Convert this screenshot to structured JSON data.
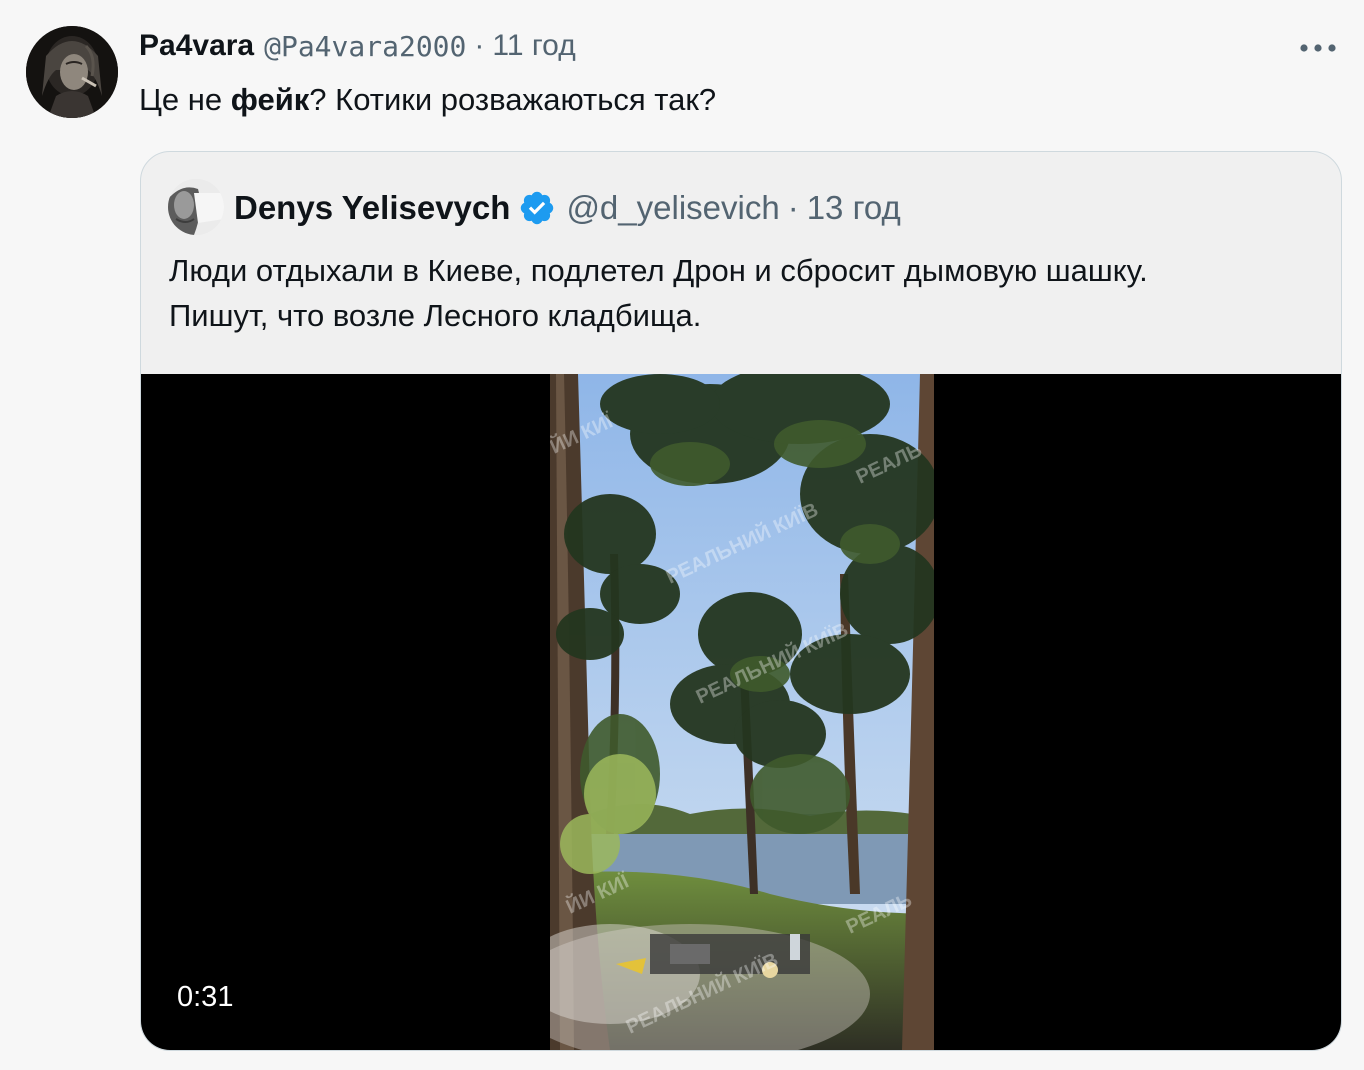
{
  "tweet": {
    "author_name": "Pa4vara",
    "author_handle": "@Pa4vara2000",
    "separator": "·",
    "timestamp": "11 год",
    "text_before": "Це не ",
    "text_bold": "фейк",
    "text_after": "? Котики розважаються так?",
    "avatar_icon": "user-avatar",
    "more_icon": "more-dots-icon"
  },
  "quote": {
    "author_name": "Denys Yelisevych",
    "verified_icon": "verified-badge-icon",
    "verified_color": "#1d9bf0",
    "author_handle": "@d_yelisevich",
    "separator": "·",
    "timestamp": "13 год",
    "text_line_1": "Люди отдыхали в Киеве, подлетел Дрон и сбросит дымовую шашку.",
    "text_line_2": "Пишут, что возле Лесного кладбища.",
    "video": {
      "duration": "0:31",
      "watermark": "РЕАЛЬНИЙ КИЇВ"
    }
  },
  "colors": {
    "background": "#f7f7f7",
    "text_primary": "#0f1419",
    "text_secondary": "#536471",
    "border": "#cfd9de"
  }
}
